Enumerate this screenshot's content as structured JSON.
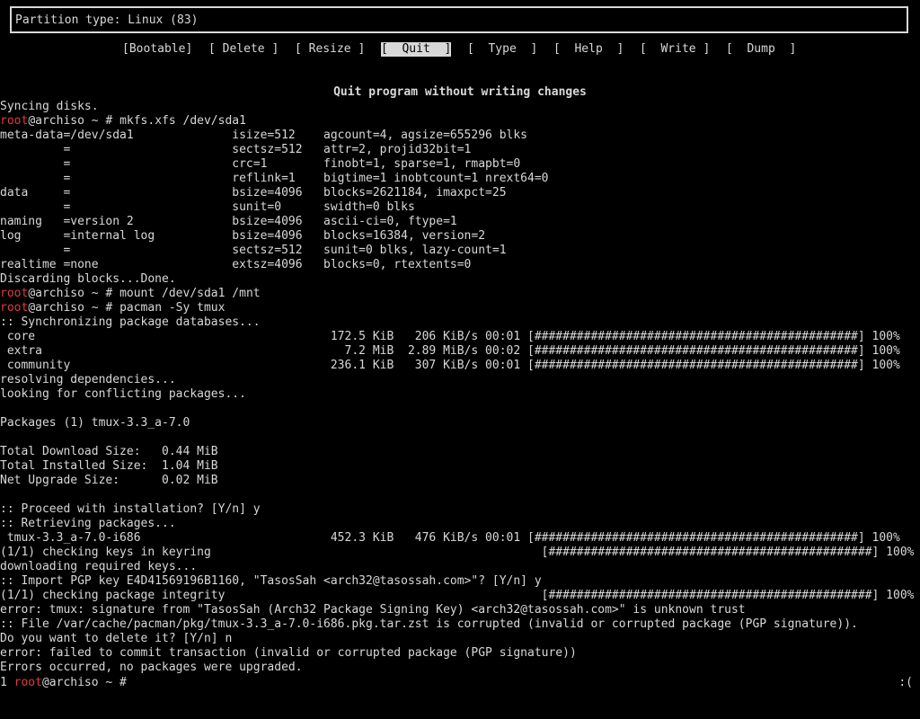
{
  "cfdisk": {
    "info": "Partition type: Linux (83)",
    "menu": [
      "[Bootable]",
      "[ Delete ]",
      "[ Resize ]",
      "[  Quit  ]",
      "[  Type  ]",
      "[  Help  ]",
      "[  Write ]",
      "[  Dump  ]"
    ],
    "selected_menu": "[  Quit  ]",
    "status": "Quit program without writing changes"
  },
  "prompt": {
    "user": "root",
    "host_suffix": "@archiso ~ # "
  },
  "terminal": {
    "lines": [
      {
        "text": "Syncing disks."
      },
      {
        "prompt": true,
        "cmd": "mkfs.xfs /dev/sda1"
      },
      {
        "text": "meta-data=/dev/sda1              isize=512    agcount=4, agsize=655296 blks"
      },
      {
        "text": "         =                       sectsz=512   attr=2, projid32bit=1"
      },
      {
        "text": "         =                       crc=1        finobt=1, sparse=1, rmapbt=0"
      },
      {
        "text": "         =                       reflink=1    bigtime=1 inobtcount=1 nrext64=0"
      },
      {
        "text": "data     =                       bsize=4096   blocks=2621184, imaxpct=25"
      },
      {
        "text": "         =                       sunit=0      swidth=0 blks"
      },
      {
        "text": "naming   =version 2              bsize=4096   ascii-ci=0, ftype=1"
      },
      {
        "text": "log      =internal log           bsize=4096   blocks=16384, version=2"
      },
      {
        "text": "         =                       sectsz=512   sunit=0 blks, lazy-count=1"
      },
      {
        "text": "realtime =none                   extsz=4096   blocks=0, rtextents=0"
      },
      {
        "text": "Discarding blocks...Done."
      },
      {
        "prompt": true,
        "cmd": "mount /dev/sda1 /mnt"
      },
      {
        "prompt": true,
        "cmd": "pacman -Sy tmux"
      },
      {
        "text": ":: Synchronizing package databases..."
      },
      {
        "text": " core                                          172.5 KiB   206 KiB/s 00:01 [##############################################] 100%"
      },
      {
        "text": " extra                                           7.2 MiB  2.89 MiB/s 00:02 [##############################################] 100%"
      },
      {
        "text": " community                                     236.1 KiB   307 KiB/s 00:01 [##############################################] 100%"
      },
      {
        "text": "resolving dependencies..."
      },
      {
        "text": "looking for conflicting packages..."
      },
      {
        "text": ""
      },
      {
        "text": "Packages (1) tmux-3.3_a-7.0"
      },
      {
        "text": ""
      },
      {
        "text": "Total Download Size:   0.44 MiB"
      },
      {
        "text": "Total Installed Size:  1.04 MiB"
      },
      {
        "text": "Net Upgrade Size:      0.02 MiB"
      },
      {
        "text": ""
      },
      {
        "text": ":: Proceed with installation? [Y/n] y"
      },
      {
        "text": ":: Retrieving packages..."
      },
      {
        "text": " tmux-3.3_a-7.0-i686                           452.3 KiB   476 KiB/s 00:01 [##############################################] 100%"
      },
      {
        "text": "(1/1) checking keys in keyring                                               [##############################################] 100%"
      },
      {
        "text": "downloading required keys..."
      },
      {
        "text": ":: Import PGP key E4D41569196B1160, \"TasosSah <arch32@tasossah.com>\"? [Y/n] y"
      },
      {
        "text": "(1/1) checking package integrity                                             [##############################################] 100%"
      },
      {
        "text": "error: tmux: signature from \"TasosSah (Arch32 Package Signing Key) <arch32@tasossah.com>\" is unknown trust"
      },
      {
        "text": ":: File /var/cache/pacman/pkg/tmux-3.3_a-7.0-i686.pkg.tar.zst is corrupted (invalid or corrupted package (PGP signature))."
      },
      {
        "text": "Do you want to delete it? [Y/n] n"
      },
      {
        "text": "error: failed to commit transaction (invalid or corrupted package (PGP signature))"
      },
      {
        "text": "Errors occurred, no packages were upgraded."
      }
    ]
  },
  "tmux": {
    "window": "1 ",
    "prompt_user": "root",
    "prompt_rest": "@archiso ~ # ",
    "right": ":("
  },
  "colors": {
    "background": "#000000",
    "foreground": "#d8d8d8",
    "prompt_user": "#e03c3c"
  }
}
